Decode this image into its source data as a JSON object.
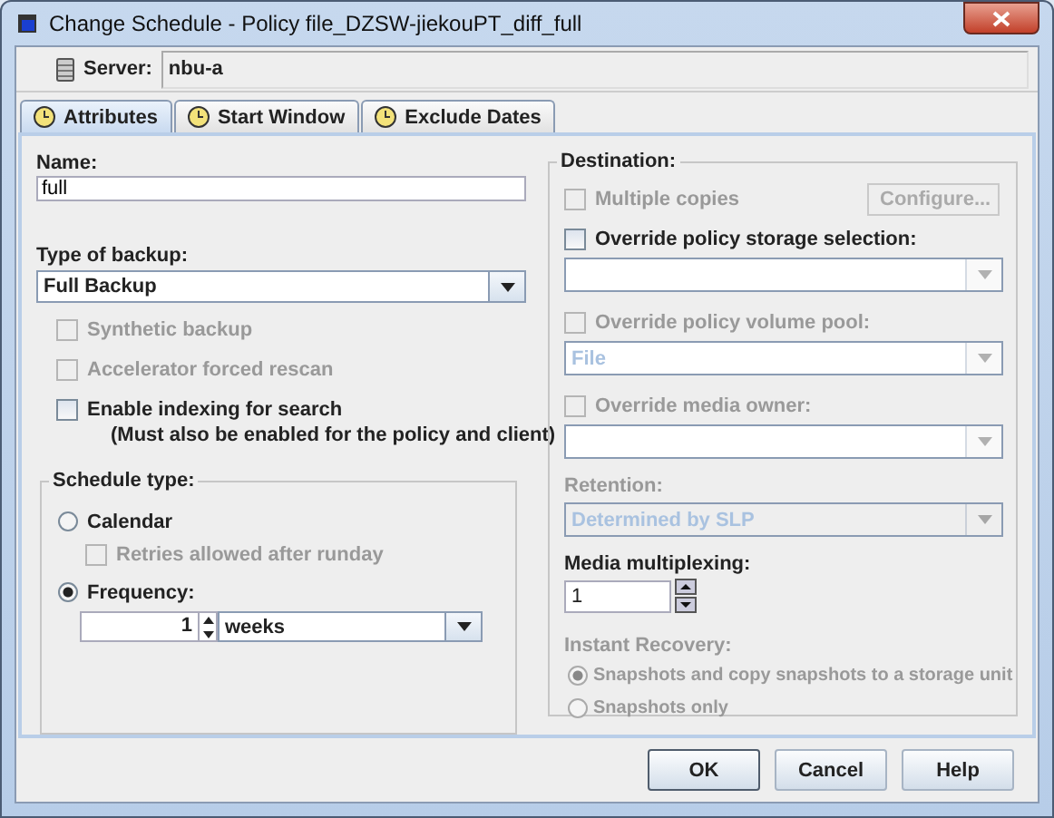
{
  "window": {
    "title": "Change Schedule - Policy file_DZSW-jiekouPT_diff_full"
  },
  "server": {
    "label": "Server:",
    "value": "nbu-a"
  },
  "tabs": [
    {
      "label": "Attributes",
      "selected": true
    },
    {
      "label": "Start Window",
      "selected": false
    },
    {
      "label": "Exclude Dates",
      "selected": false
    }
  ],
  "name": {
    "label": "Name:",
    "value": "full"
  },
  "backup_type": {
    "label": "Type of backup:",
    "value": "Full Backup"
  },
  "options": [
    {
      "label": "Synthetic backup",
      "checked": false,
      "disabled": true
    },
    {
      "label": "Accelerator forced rescan",
      "checked": false,
      "disabled": true
    },
    {
      "label": "Enable indexing for search",
      "checked": false,
      "disabled": false,
      "note": "(Must also be enabled for the policy and client)"
    }
  ],
  "schedule_type": {
    "title": "Schedule type:",
    "calendar": {
      "label": "Calendar",
      "selected": false
    },
    "retries": {
      "label": "Retries allowed after runday",
      "checked": false,
      "disabled": true
    },
    "frequency": {
      "label": "Frequency:",
      "selected": true,
      "value": "1",
      "unit": "weeks"
    }
  },
  "destination": {
    "title": "Destination:",
    "multiple_copies": {
      "label": "Multiple copies",
      "checked": false,
      "disabled": true
    },
    "configure_button": {
      "label": "Configure...",
      "disabled": true
    },
    "rows": [
      {
        "kind": "check-combo",
        "label": "Override policy storage selection:",
        "checked": false,
        "disabled": false,
        "combo_disabled": true
      },
      {
        "kind": "check-combo",
        "label": "Override policy volume pool:",
        "checked": false,
        "disabled": true,
        "combo_disabled": true,
        "value": "File"
      },
      {
        "kind": "check-combo",
        "label": "Override media owner:",
        "checked": false,
        "disabled": true,
        "combo_disabled": true
      },
      {
        "kind": "combo",
        "label": "Retention:",
        "disabled": true,
        "value": "Determined by SLP"
      }
    ]
  },
  "media_multiplexing": {
    "label": "Media multiplexing:",
    "value": "1"
  },
  "instant_recovery": {
    "label": "Instant Recovery:",
    "disabled": true,
    "options": [
      {
        "label": "Snapshots and copy snapshots to a storage unit",
        "selected": true
      },
      {
        "label": "Snapshots only",
        "selected": false
      }
    ]
  },
  "buttons": [
    {
      "label": "OK",
      "default": true
    },
    {
      "label": "Cancel",
      "default": false
    },
    {
      "label": "Help",
      "default": false
    }
  ]
}
